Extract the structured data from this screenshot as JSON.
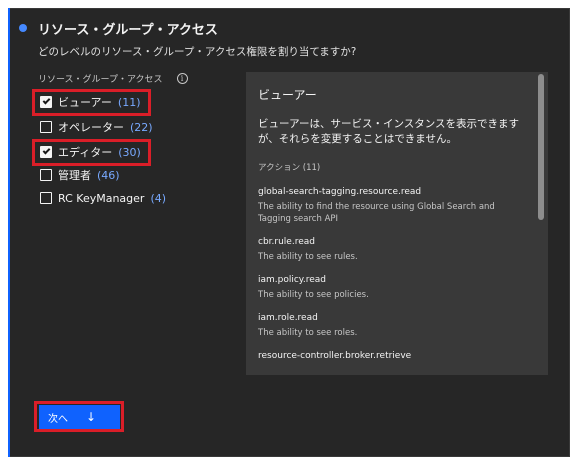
{
  "step": {
    "title": "リソース・グループ・アクセス",
    "question": "どのレベルのリソース・グループ・アクセス権限を割り当てますか?"
  },
  "group_label": "リソース・グループ・アクセス",
  "info_icon": "info-icon",
  "roles": [
    {
      "label": "ビューアー",
      "count": "(11)",
      "checked": true
    },
    {
      "label": "オペレーター",
      "count": "(22)",
      "checked": false
    },
    {
      "label": "エディター",
      "count": "(30)",
      "checked": true
    },
    {
      "label": "管理者",
      "count": "(46)",
      "checked": false
    },
    {
      "label": "RC KeyManager",
      "count": "(4)",
      "checked": false
    }
  ],
  "panel": {
    "title": "ビューアー",
    "description": "ビューアーは、サービス・インスタンスを表示できますが、それらを変更することはできません。",
    "actions_heading": "アクション (11)",
    "actions": [
      {
        "name": "global-search-tagging.resource.read",
        "desc": "The ability to find the resource using Global Search and Tagging search API"
      },
      {
        "name": "cbr.rule.read",
        "desc": "The ability to see rules."
      },
      {
        "name": "iam.policy.read",
        "desc": "The ability to see policies."
      },
      {
        "name": "iam.role.read",
        "desc": "The ability to see roles."
      },
      {
        "name": "resource-controller.broker.retrieve",
        "desc": ""
      }
    ]
  },
  "next_button": {
    "label": "次へ",
    "icon": "arrow-down-icon"
  },
  "colors": {
    "accent": "#0f62fe",
    "link": "#78a9ff",
    "highlight": "#da1e28",
    "background": "#262626"
  }
}
